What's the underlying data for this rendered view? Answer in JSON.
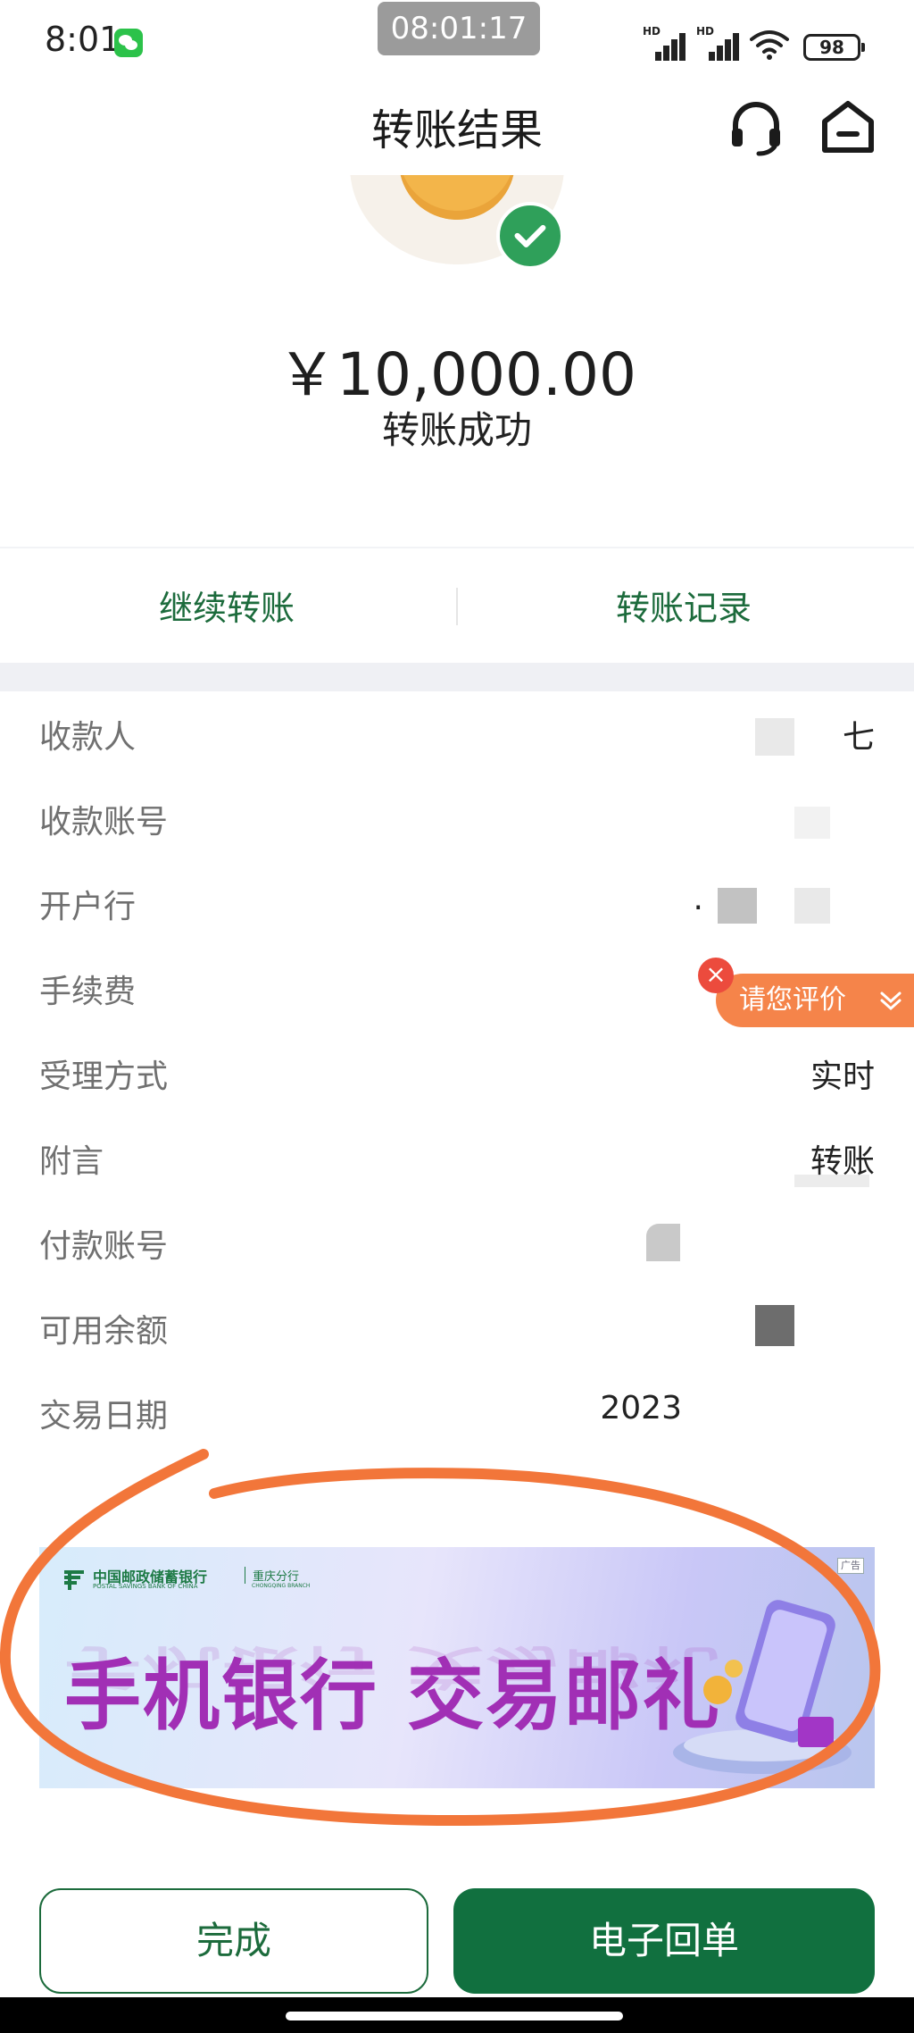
{
  "status_bar": {
    "time": "8:01",
    "screen_record_time": "08:01:17",
    "network_label_1": "HD",
    "network_label_2": "HD",
    "battery": "98"
  },
  "header": {
    "title": "转账结果",
    "icons": [
      "headset-icon",
      "home-icon"
    ]
  },
  "result": {
    "amount": "￥10,000.00",
    "status": "转账成功"
  },
  "actions": {
    "continue_label": "继续转账",
    "records_label": "转账记录"
  },
  "details": [
    {
      "label": "收款人",
      "value": "七"
    },
    {
      "label": "收款账号",
      "value": ""
    },
    {
      "label": "开户行",
      "value": "."
    },
    {
      "label": "手续费",
      "value": ""
    },
    {
      "label": "受理方式",
      "value": "实时"
    },
    {
      "label": "附言",
      "value": "转账"
    },
    {
      "label": "付款账号",
      "value": ""
    },
    {
      "label": "可用余额",
      "value": ""
    },
    {
      "label": "交易日期",
      "value": "2023"
    }
  ],
  "rating": {
    "label": "请您评价",
    "close": "×"
  },
  "banner": {
    "bank_name": "中国邮政储蓄银行",
    "bank_name_en": "POSTAL SAVINGS BANK OF CHINA",
    "branch": "重庆分行",
    "branch_en": "CHONGQING BRANCH",
    "ad_tag": "广告",
    "headline": "手机银行 交易邮礼"
  },
  "buttons": {
    "done": "完成",
    "receipt": "电子回单"
  },
  "colors": {
    "brand_green": "#11703f",
    "link_green": "#1c6b3c",
    "rating_orange": "#f5844a",
    "annotation_orange": "#f2763a"
  }
}
